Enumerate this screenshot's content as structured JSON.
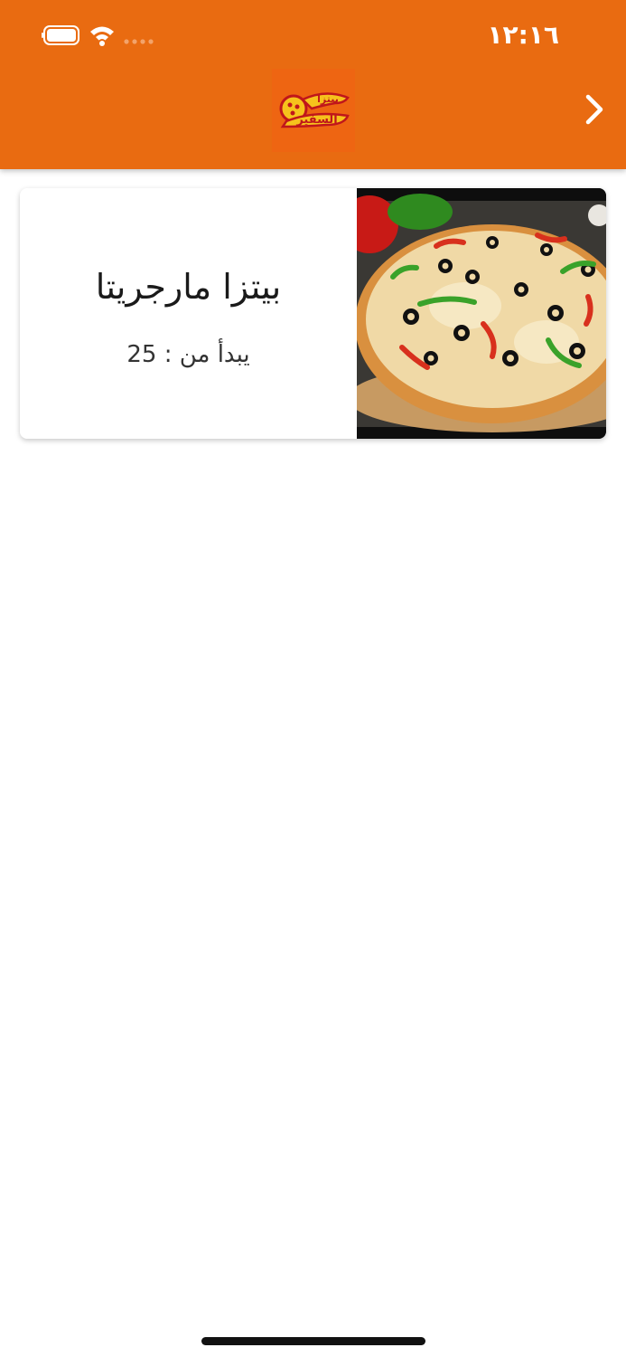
{
  "status_bar": {
    "time": "١٢:١٦"
  },
  "header": {
    "logo_text": "بيتزا السفير",
    "back_icon": "chevron-right-icon"
  },
  "product": {
    "name": "بيتزا مارجريتا",
    "price_line": "يبدأ من : 25",
    "image_icon": "pizza-image"
  },
  "colors": {
    "brand": "#e96b11",
    "logo_red": "#c0161b",
    "logo_yellow": "#f6c21c"
  }
}
